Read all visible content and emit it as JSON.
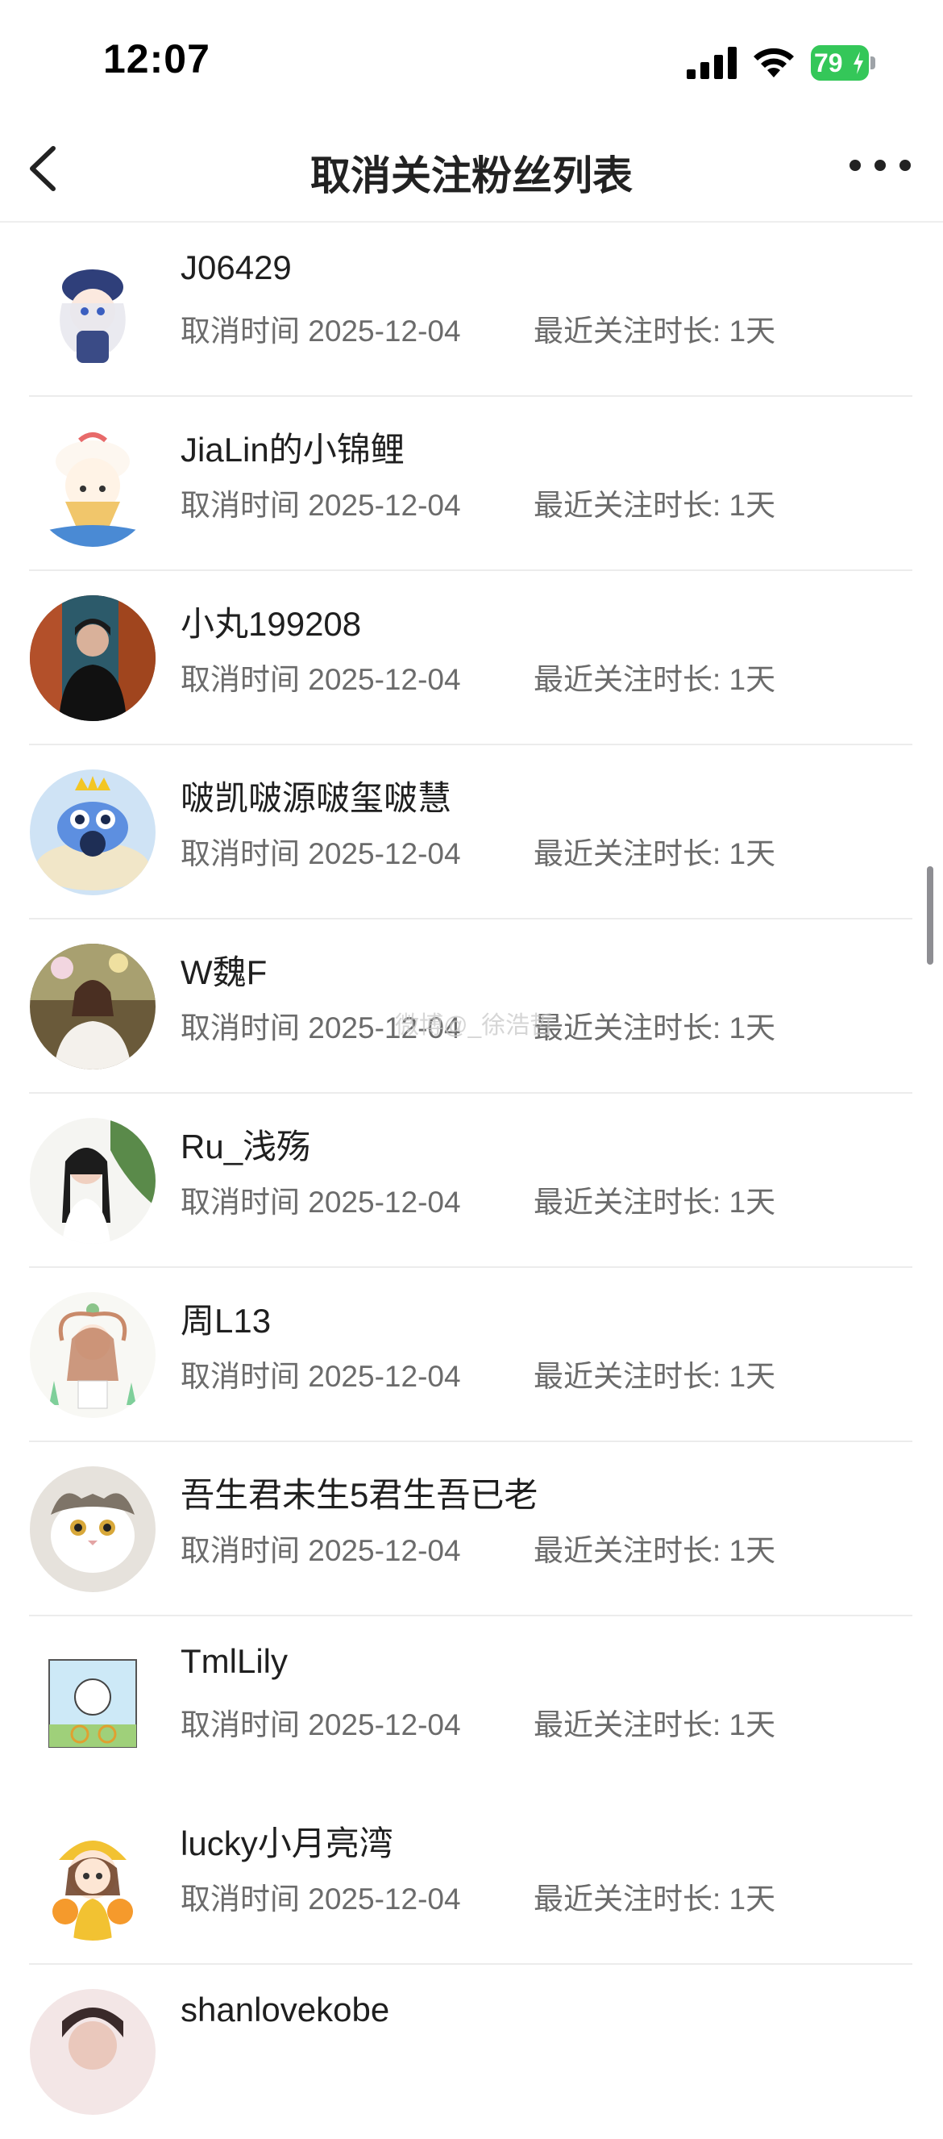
{
  "status_bar": {
    "time": "12:07",
    "battery": "79"
  },
  "header": {
    "title": "取消关注粉丝列表",
    "back_icon": "chevron-left-icon",
    "more_icon": "more-dots-icon"
  },
  "watermark": "微博@_徐浩哲",
  "users": [
    {
      "name": "J06429",
      "cancel_label": "取消时间 2025-12-04",
      "duration_label": "最近关注时长: 1天"
    },
    {
      "name": "JiaLin的小锦鲤",
      "cancel_label": "取消时间 2025-12-04",
      "duration_label": "最近关注时长: 1天"
    },
    {
      "name": "小丸199208",
      "cancel_label": "取消时间 2025-12-04",
      "duration_label": "最近关注时长: 1天"
    },
    {
      "name": "啵凯啵源啵玺啵慧",
      "cancel_label": "取消时间 2025-12-04",
      "duration_label": "最近关注时长: 1天"
    },
    {
      "name": "W魏F",
      "cancel_label": "取消时间 2025-12-04",
      "duration_label": "最近关注时长: 1天"
    },
    {
      "name": "Ru_浅殇",
      "cancel_label": "取消时间 2025-12-04",
      "duration_label": "最近关注时长: 1天"
    },
    {
      "name": "周L13",
      "cancel_label": "取消时间 2025-12-04",
      "duration_label": "最近关注时长: 1天"
    },
    {
      "name": "吾生君未生5君生吾已老",
      "cancel_label": "取消时间 2025-12-04",
      "duration_label": "最近关注时长: 1天"
    },
    {
      "name": "TmlLily",
      "cancel_label": "取消时间 2025-12-04",
      "duration_label": "最近关注时长: 1天"
    },
    {
      "name": "lucky小月亮湾",
      "cancel_label": "取消时间 2025-12-04",
      "duration_label": "最近关注时长: 1天"
    },
    {
      "name": "shanlovekobe",
      "cancel_label": "",
      "duration_label": ""
    }
  ]
}
